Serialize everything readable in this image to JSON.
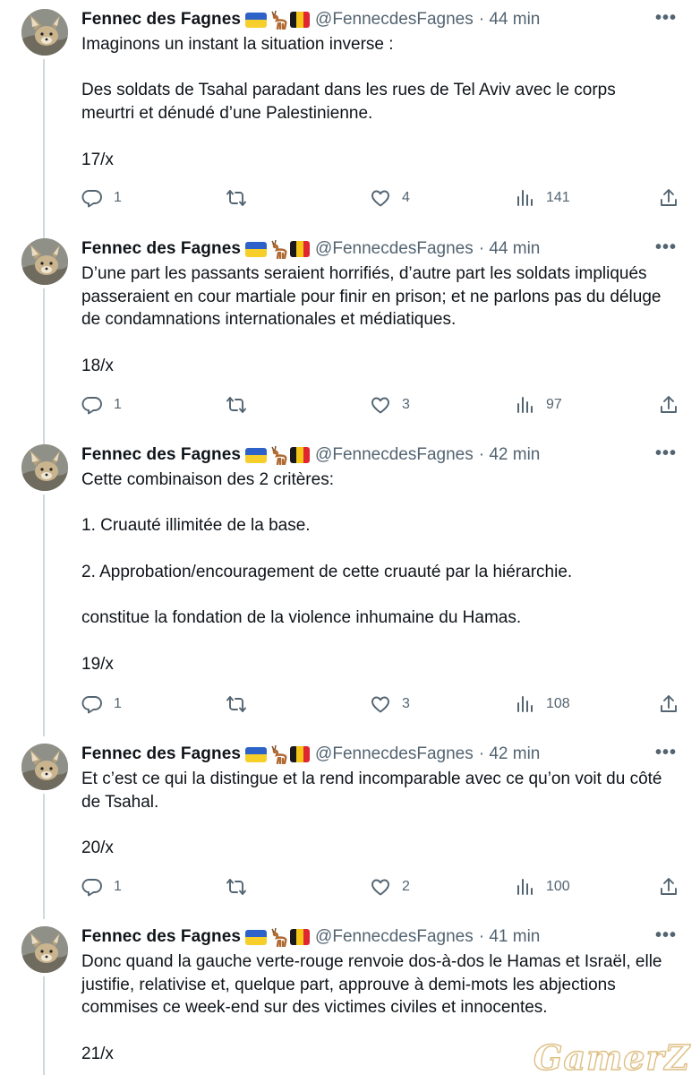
{
  "tweets": [
    {
      "display_name": "Fennec des Fagnes",
      "handle": "@FennecdesFagnes",
      "time": "· 44 min",
      "text": "Imaginons un instant la situation inverse :\n\nDes soldats de Tsahal paradant dans les rues de Tel Aviv avec le corps meurtri et dénudé d’une Palestinienne.\n\n17/x",
      "replies": "1",
      "retweets": "",
      "likes": "4",
      "views": "141"
    },
    {
      "display_name": "Fennec des Fagnes",
      "handle": "@FennecdesFagnes",
      "time": "· 44 min",
      "text": "D’une part les passants seraient horrifiés, d’autre part les soldats impliqués passeraient en cour martiale pour finir en prison; et ne parlons pas du déluge de condamnations internationales et médiatiques.\n\n18/x",
      "replies": "1",
      "retweets": "",
      "likes": "3",
      "views": "97"
    },
    {
      "display_name": "Fennec des Fagnes",
      "handle": "@FennecdesFagnes",
      "time": "· 42 min",
      "text": "Cette combinaison des 2 critères:\n\n1. Cruauté illimitée de la base.\n\n2. Approbation/encouragement de cette cruauté par la hiérarchie.\n\nconstitue la fondation de la violence inhumaine du Hamas.\n\n19/x",
      "replies": "1",
      "retweets": "",
      "likes": "3",
      "views": "108"
    },
    {
      "display_name": "Fennec des Fagnes",
      "handle": "@FennecdesFagnes",
      "time": "· 42 min",
      "text": "Et c’est ce qui la distingue et la rend incomparable avec ce qu’on voit du côté de Tsahal.\n\n20/x",
      "replies": "1",
      "retweets": "",
      "likes": "2",
      "views": "100"
    },
    {
      "display_name": "Fennec des Fagnes",
      "handle": "@FennecdesFagnes",
      "time": "· 41 min",
      "text": "Donc quand la gauche verte-rouge renvoie dos-à-dos le Hamas et Israël, elle justifie, relativise et, quelque part, approuve à demi-mots les abjections commises ce week-end sur des victimes civiles et innocentes.\n\n21/x",
      "replies": "",
      "retweets": "",
      "likes": "",
      "views": ""
    }
  ],
  "more_glyph": "•••",
  "watermark": "GamerZ",
  "icons": {
    "reply": "reply-icon",
    "retweet": "retweet-icon",
    "like": "heart-icon",
    "views": "views-icon",
    "share": "share-icon",
    "more": "more-icon",
    "flags": [
      "ukraine-flag-icon",
      "deer-icon",
      "belgium-flag-icon"
    ]
  },
  "colors": {
    "text": "#0f1419",
    "secondary": "#536471",
    "thread_line": "#cfd9de",
    "ukraine_blue": "#2d63c9",
    "ukraine_yellow": "#f7cf2b",
    "belgium_black": "#1a1a1a",
    "belgium_yellow": "#f5c518",
    "belgium_red": "#e0262f"
  }
}
